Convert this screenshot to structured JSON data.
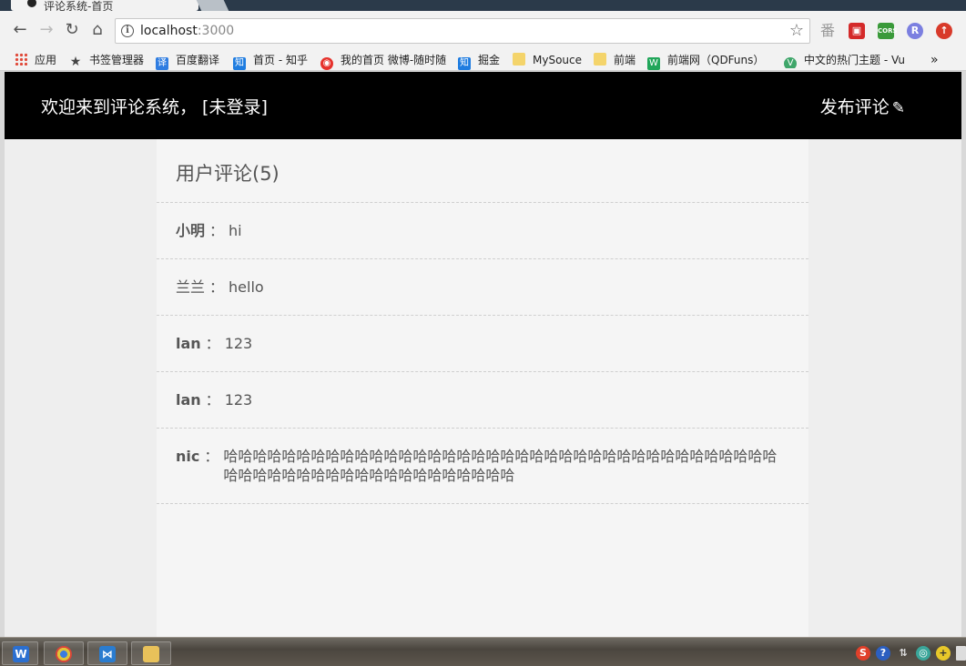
{
  "browser": {
    "tab_title": "评论系统-首页",
    "url_host": "localhost",
    "url_port": ":3000",
    "bookmarks": [
      "应用",
      "书签管理器",
      "百度翻译",
      "首页 - 知乎",
      "我的首页 微博-随时随",
      "掘金",
      "MySouce",
      "前端",
      "前端网（QDFuns）",
      "中文的热门主题 - Vu"
    ],
    "overflow_label": "»",
    "ext_fan": "番"
  },
  "header": {
    "brand": "欢迎来到评论系统， [未登录]",
    "publish_label": "发布评论"
  },
  "comments_section": {
    "title": "用户评论(5)",
    "separator": "：",
    "comments": [
      {
        "author": "小明",
        "text": "hi"
      },
      {
        "author": "兰兰",
        "text": "hello"
      },
      {
        "author": "lan",
        "text": "123"
      },
      {
        "author": "lan",
        "text": "123"
      },
      {
        "author": "nic",
        "text": "哈哈哈哈哈哈哈哈哈哈哈哈哈哈哈哈哈哈哈哈哈哈哈哈哈哈哈哈哈哈哈哈哈哈哈哈哈哈哈哈哈哈哈哈哈哈哈哈哈哈哈哈哈哈哈哈哈哈"
      }
    ]
  },
  "colors": {
    "header_bg": "#000000",
    "page_bg": "#eeeeee",
    "content_bg": "#f5f5f5",
    "text": "#555555"
  }
}
